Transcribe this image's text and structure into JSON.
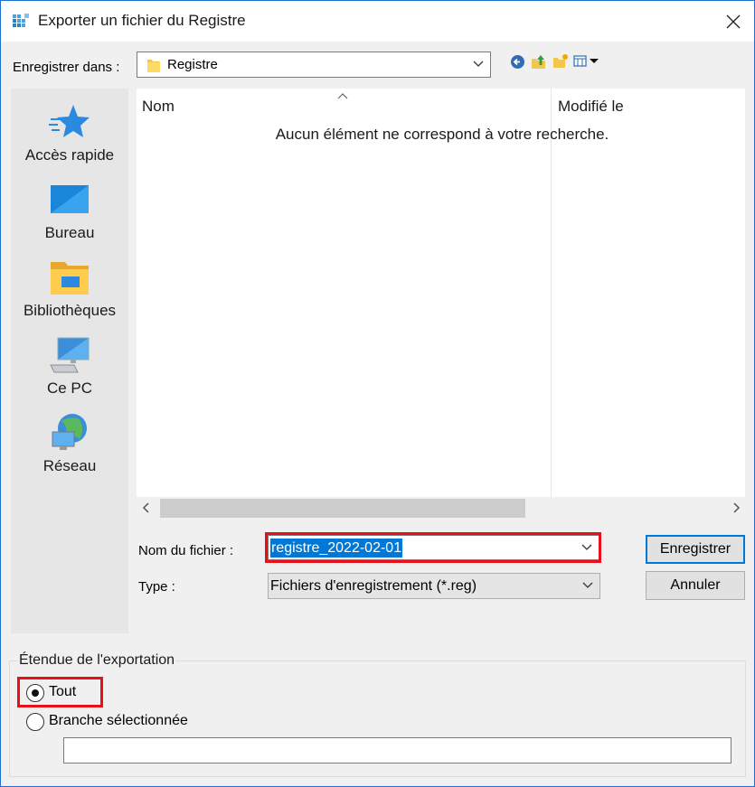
{
  "window": {
    "title": "Exporter un fichier du Registre",
    "accent_color": "#0078d7",
    "highlight_color": "#e8101a"
  },
  "location": {
    "label": "Enregistrer dans :",
    "value": "Registre",
    "icon": "folder-icon"
  },
  "toolbar": {
    "icons": [
      "back-icon",
      "up-folder-icon",
      "new-folder-icon",
      "view-menu-icon"
    ]
  },
  "places": [
    {
      "label": "Accès rapide",
      "icon": "star-icon"
    },
    {
      "label": "Bureau",
      "icon": "desktop-icon"
    },
    {
      "label": "Bibliothèques",
      "icon": "libraries-icon"
    },
    {
      "label": "Ce PC",
      "icon": "computer-icon"
    },
    {
      "label": "Réseau",
      "icon": "network-icon"
    }
  ],
  "file_list": {
    "columns": [
      "Nom",
      "Modifié le"
    ],
    "empty_message": "Aucun élément ne correspond à votre recherche."
  },
  "filename": {
    "label": "Nom du fichier :",
    "value": "registre_2022-02-01"
  },
  "type": {
    "label": "Type :",
    "value": "Fichiers d'enregistrement (*.reg)"
  },
  "buttons": {
    "save": "Enregistrer",
    "cancel": "Annuler"
  },
  "export_range": {
    "title": "Étendue de l'exportation",
    "options": [
      {
        "label": "Tout",
        "checked": true
      },
      {
        "label": "Branche sélectionnée",
        "checked": false
      }
    ],
    "branch_value": ""
  }
}
